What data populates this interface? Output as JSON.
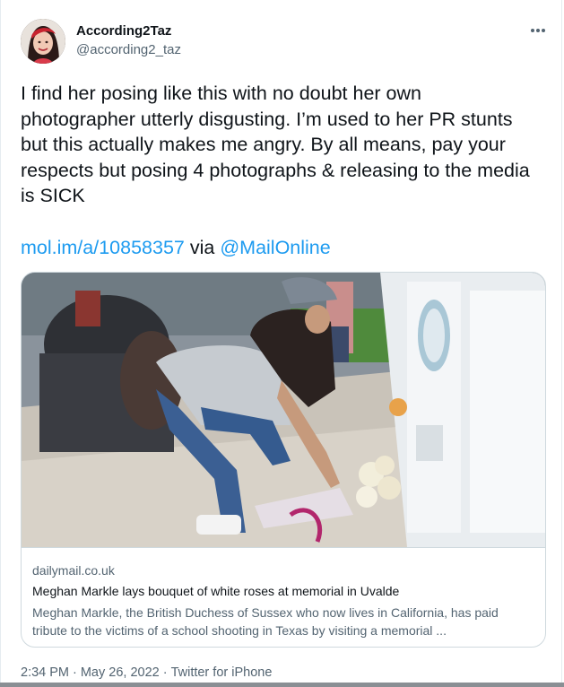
{
  "user": {
    "display_name": "According2Taz",
    "handle": "@according2_taz"
  },
  "tweet": {
    "text": "I find her posing like this with no doubt her own photographer utterly disgusting. I’m used to her PR stunts but this actually makes me angry. By all means, pay your respects but posing 4 photographs & releasing to the media is SICK",
    "link": "mol.im/a/10858357",
    "via_label": "via",
    "mention": "@MailOnline"
  },
  "card": {
    "domain": "dailymail.co.uk",
    "title": "Meghan Markle lays bouquet of white roses at memorial in Uvalde",
    "description": "Meghan Markle, the British Duchess of Sussex who now lives in California, has paid tribute to the victims of a school shooting in Texas by visiting a memorial ..."
  },
  "meta": {
    "time": "2:34 PM",
    "date": "May 26, 2022",
    "source": "Twitter for iPhone",
    "separator": "·"
  },
  "icons": {
    "more": "more-options-icon"
  },
  "colors": {
    "link": "#1d9bf0",
    "text": "#0f1419",
    "secondary": "#536471",
    "border": "#cfd9de"
  }
}
